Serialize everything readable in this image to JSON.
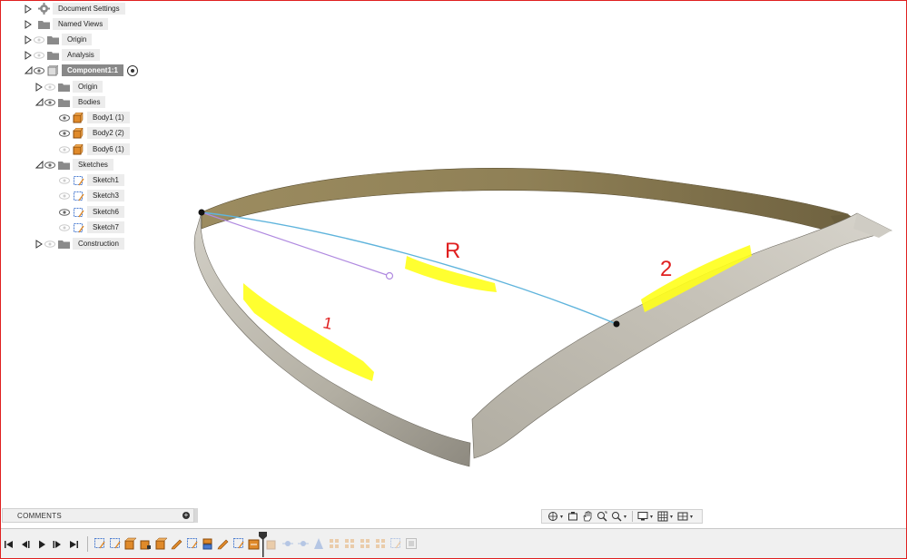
{
  "browser": {
    "items": [
      {
        "label": "Document Settings",
        "icon": "gear-icon",
        "expanded": false
      },
      {
        "label": "Named Views",
        "icon": "folder-icon",
        "expanded": false
      },
      {
        "label": "Origin",
        "icon": "folder-icon",
        "expanded": false
      },
      {
        "label": "Analysis",
        "icon": "folder-icon",
        "expanded": false
      },
      {
        "label": "Component1:1",
        "icon": "component-icon",
        "expanded": true
      },
      {
        "label": "Origin",
        "icon": "folder-icon",
        "expanded": false
      },
      {
        "label": "Bodies",
        "icon": "folder-icon",
        "expanded": true
      },
      {
        "label": "Body1 (1)",
        "icon": "body-icon"
      },
      {
        "label": "Body2 (2)",
        "icon": "body-icon"
      },
      {
        "label": "Body6 (1)",
        "icon": "body-icon"
      },
      {
        "label": "Sketches",
        "icon": "folder-icon",
        "expanded": true
      },
      {
        "label": "Sketch1",
        "icon": "sketch-icon"
      },
      {
        "label": "Sketch3",
        "icon": "sketch-icon"
      },
      {
        "label": "Sketch6",
        "icon": "sketch-icon"
      },
      {
        "label": "Sketch7",
        "icon": "sketch-icon"
      },
      {
        "label": "Construction",
        "icon": "folder-icon",
        "expanded": false
      }
    ]
  },
  "annotations": {
    "r_label": "R",
    "one_label": "1",
    "two_label": "2"
  },
  "comments": {
    "label": "COMMENTS"
  },
  "colors": {
    "surface_top": "#8c7d55",
    "surface_side": "#b9b5aa",
    "highlight": "#ffff1a",
    "annotation_red": "#e02020",
    "sketch_blue": "#5fb4dc",
    "sketch_purple": "#b08ae0",
    "selection": "#888888",
    "body_orange": "#e08a2a"
  }
}
